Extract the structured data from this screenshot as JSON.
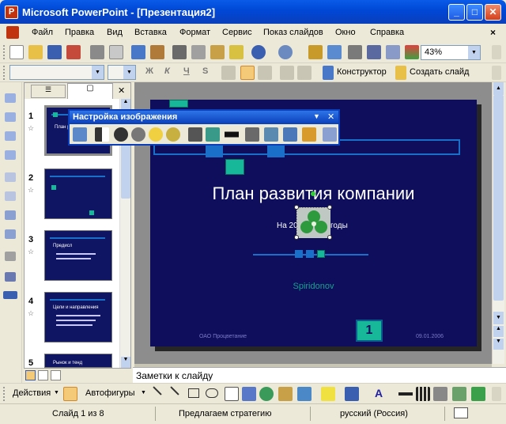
{
  "window": {
    "title": "Microsoft PowerPoint - [Презентация2]",
    "app_icon": "powerpoint-icon",
    "minimize": "_",
    "maximize": "□",
    "close": "✕"
  },
  "menu": {
    "items": [
      "Файл",
      "Правка",
      "Вид",
      "Вставка",
      "Формат",
      "Сервис",
      "Показ слайдов",
      "Окно",
      "Справка"
    ],
    "close_doc": "×"
  },
  "toolbar": {
    "zoom": "43%"
  },
  "formatting": {
    "bold": "Ж",
    "italic": "К",
    "underline": "Ч",
    "shadow": "S",
    "designer": "Конструктор",
    "new_slide": "Создать слайд"
  },
  "thumbnails": {
    "slides": [
      {
        "num": "1",
        "title": "План развития компании"
      },
      {
        "num": "2",
        "title": ""
      },
      {
        "num": "3",
        "title": "Предисл"
      },
      {
        "num": "4",
        "title": "Цели и направления"
      },
      {
        "num": "5",
        "title": "Рынок и тенд"
      }
    ]
  },
  "picture_toolbar": {
    "title": "Настройка изображения",
    "menu": "▼",
    "close": "✕"
  },
  "slide": {
    "title": "План развития компании",
    "subtitle_left": "На 20",
    "subtitle_right": "годы",
    "author": "Spiridonov",
    "footer_left": "ОАО Процветание",
    "footer_date": "09.01.2006",
    "slide_number": "1"
  },
  "notes": {
    "placeholder": "Заметки к слайду"
  },
  "drawing": {
    "actions": "Действия",
    "autoshapes": "Автофигуры"
  },
  "status": {
    "slide_of": "Слайд 1 из 8",
    "design": "Предлагаем стратегию",
    "language": "русский (Россия)"
  },
  "colors": {
    "title_bar": "#0A5BE8",
    "slide_bg": "#0E0E5C",
    "accent_teal": "#17B89A",
    "accent_blue": "#1A6FC9"
  }
}
